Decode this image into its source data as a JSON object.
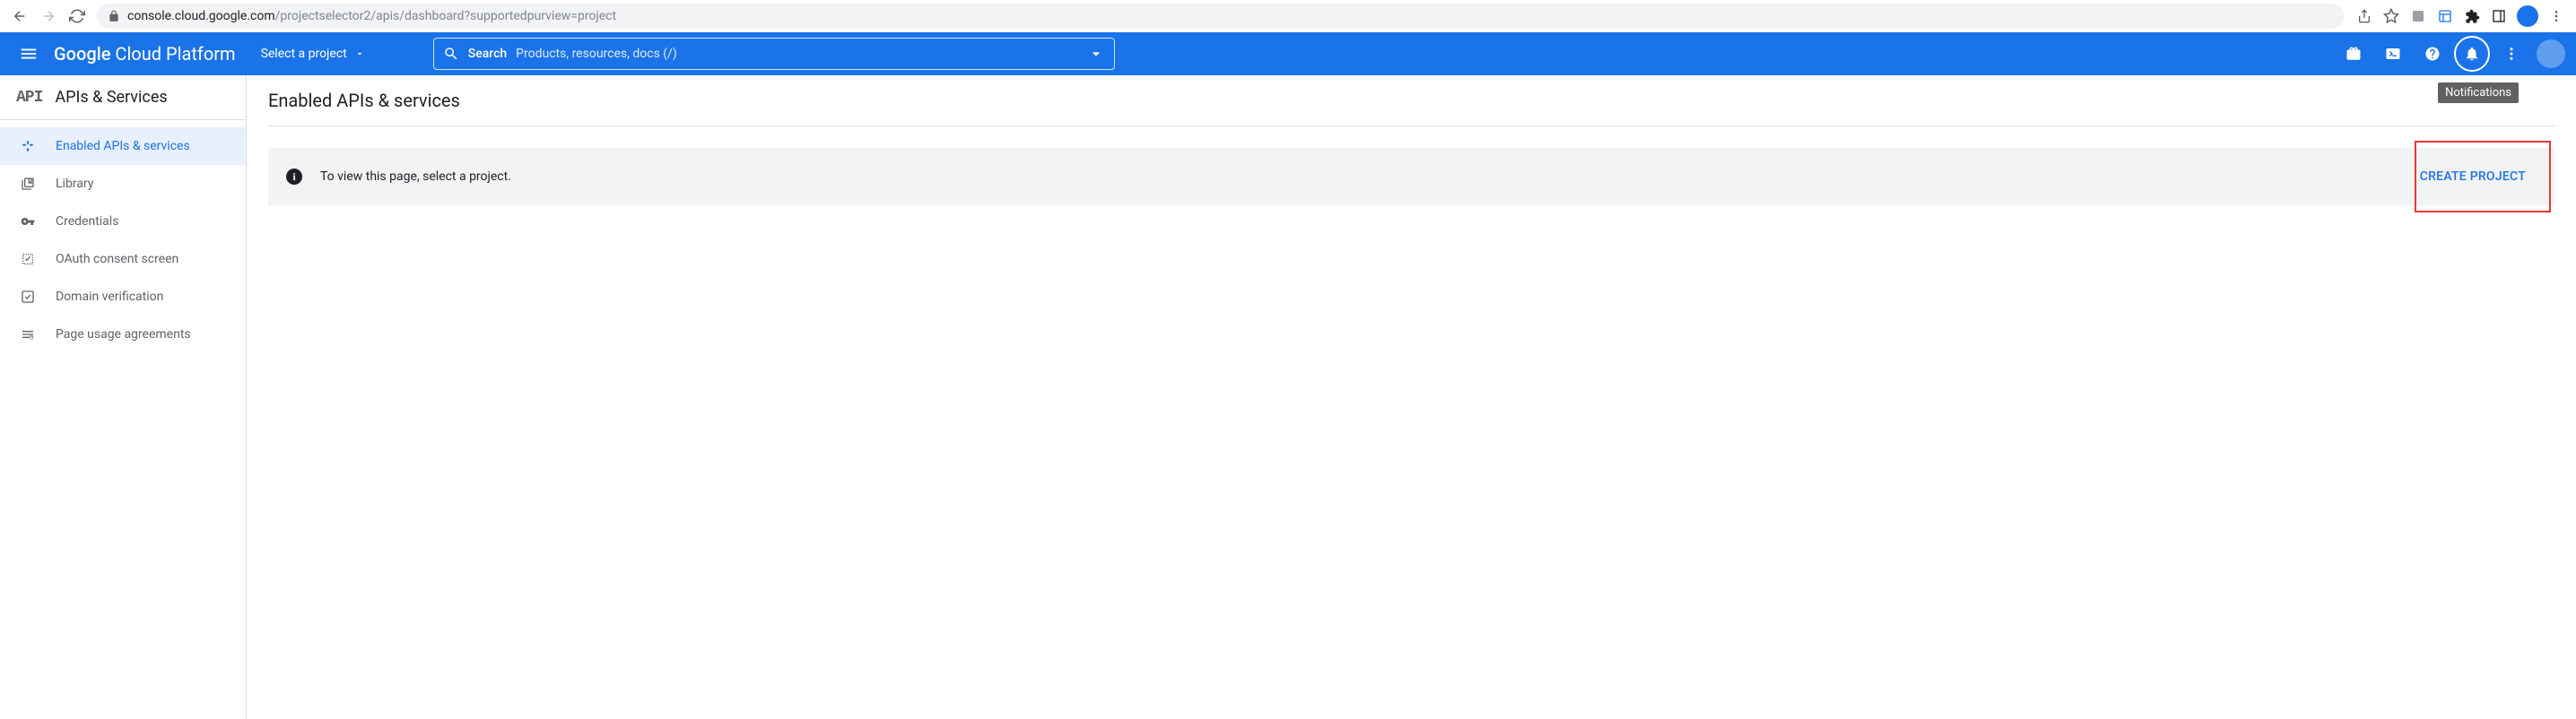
{
  "browser": {
    "url_host": "console.cloud.google.com",
    "url_path": "/projectselector2/apis/dashboard?supportedpurview=project"
  },
  "header": {
    "logo_text": "Google Cloud Platform",
    "project_selector_label": "Select a project",
    "search_label": "Search",
    "search_placeholder": "Products, resources, docs (/)",
    "tooltip": "Notifications"
  },
  "sidebar": {
    "section_title": "APIs & Services",
    "items": [
      {
        "label": "Enabled APIs & services",
        "icon": "dashboard"
      },
      {
        "label": "Library",
        "icon": "library"
      },
      {
        "label": "Credentials",
        "icon": "key"
      },
      {
        "label": "OAuth consent screen",
        "icon": "consent"
      },
      {
        "label": "Domain verification",
        "icon": "check"
      },
      {
        "label": "Page usage agreements",
        "icon": "agreements"
      }
    ]
  },
  "main": {
    "page_title": "Enabled APIs & services",
    "banner_text": "To view this page, select a project.",
    "create_button": "CREATE PROJECT"
  }
}
